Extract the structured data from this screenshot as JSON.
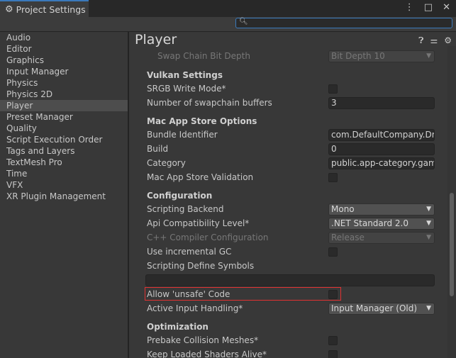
{
  "window": {
    "tab_title": "Project Settings",
    "tab_icon": "gear-icon",
    "controls": [
      "⋮",
      "□",
      "✕"
    ]
  },
  "search": {
    "placeholder": ""
  },
  "sidebar": {
    "items": [
      {
        "label": "Audio"
      },
      {
        "label": "Editor"
      },
      {
        "label": "Graphics"
      },
      {
        "label": "Input Manager"
      },
      {
        "label": "Physics"
      },
      {
        "label": "Physics 2D"
      },
      {
        "label": "Player",
        "selected": true
      },
      {
        "label": "Preset Manager"
      },
      {
        "label": "Quality"
      },
      {
        "label": "Script Execution Order"
      },
      {
        "label": "Tags and Layers"
      },
      {
        "label": "TextMesh Pro"
      },
      {
        "label": "Time"
      },
      {
        "label": "VFX"
      },
      {
        "label": "XR Plugin Management"
      }
    ]
  },
  "main": {
    "title": "Player",
    "header_icons": [
      "help-icon",
      "sliders-icon",
      "gear-icon"
    ],
    "swap_chain": {
      "label": "Swap Chain Bit Depth",
      "value": "Bit Depth 10"
    },
    "vulkan": {
      "heading": "Vulkan Settings",
      "srgb": {
        "label": "SRGB Write Mode*",
        "checked": false
      },
      "swapchain_buffers": {
        "label": "Number of swapchain buffers",
        "value": "3"
      }
    },
    "mac": {
      "heading": "Mac App Store Options",
      "bundle": {
        "label": "Bundle Identifier",
        "value": "com.DefaultCompany.Dra"
      },
      "build": {
        "label": "Build",
        "value": "0"
      },
      "category": {
        "label": "Category",
        "value": "public.app-category.game"
      },
      "validation": {
        "label": "Mac App Store Validation",
        "checked": false
      }
    },
    "config": {
      "heading": "Configuration",
      "backend": {
        "label": "Scripting Backend",
        "value": "Mono"
      },
      "api": {
        "label": "Api Compatibility Level*",
        "value": ".NET Standard 2.0"
      },
      "cpp": {
        "label": "C++ Compiler Configuration",
        "value": "Release"
      },
      "incremental_gc": {
        "label": "Use incremental GC",
        "checked": false
      },
      "define_symbols": {
        "label": "Scripting Define Symbols",
        "value": ""
      },
      "unsafe": {
        "label": "Allow 'unsafe' Code",
        "checked": false
      },
      "input_handling": {
        "label": "Active Input Handling*",
        "value": "Input Manager (Old)"
      }
    },
    "optimization": {
      "heading": "Optimization",
      "prebake": {
        "label": "Prebake Collision Meshes*",
        "checked": false
      },
      "keep_shaders": {
        "label": "Keep Loaded Shaders Alive*",
        "checked": false
      }
    }
  },
  "colors": {
    "highlight_border": "#e03232",
    "accent": "#3a79bb",
    "background": "#383838"
  }
}
